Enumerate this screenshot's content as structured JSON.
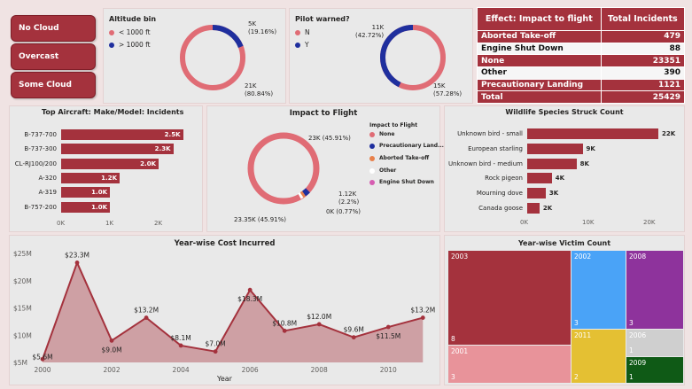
{
  "slicer": {
    "buttons": [
      "No Cloud",
      "Overcast",
      "Some Cloud"
    ]
  },
  "altitude": {
    "title": "Altitude bin",
    "legend": [
      {
        "label": "< 1000 ft",
        "color": "#e06c75"
      },
      {
        "label": "> 1000 ft",
        "color": "#1f2f9e"
      }
    ],
    "label_small_val": "5K",
    "label_small_pct": "(19.16%)",
    "label_large_val": "21K",
    "label_large_pct": "(80.84%)",
    "fraction_blue": 0.1916
  },
  "pilot": {
    "title": "Pilot warned?",
    "legend": [
      {
        "label": "N",
        "color": "#e06c75"
      },
      {
        "label": "Y",
        "color": "#1f2f9e"
      }
    ],
    "label_y_val": "11K",
    "label_y_pct": "(42.72%)",
    "label_n_val": "15K",
    "label_n_pct": "(57.28%)",
    "fraction_blue": 0.4272
  },
  "impact_table": {
    "headers": [
      "Effect: Impact to flight",
      "Total Incidents"
    ],
    "rows": [
      {
        "effect": "Aborted Take-off",
        "count": "479"
      },
      {
        "effect": "Engine Shut Down",
        "count": "88"
      },
      {
        "effect": "None",
        "count": "23351"
      },
      {
        "effect": "Other",
        "count": "390"
      },
      {
        "effect": "Precautionary Landing",
        "count": "1121"
      }
    ],
    "total_label": "Total",
    "total_value": "25429"
  },
  "aircraft": {
    "title": "Top Aircraft: Make/Model: Incidents",
    "categories": [
      "B-737-700",
      "B-737-300",
      "CL-RJ100/200",
      "A-320",
      "A-319",
      "B-757-200"
    ],
    "values": [
      2.5,
      2.3,
      2.0,
      1.2,
      1.0,
      1.0
    ],
    "value_labels": [
      "2.5K",
      "2.3K",
      "2.0K",
      "1.2K",
      "1.0K",
      "1.0K"
    ],
    "ticks": [
      "0K",
      "1K",
      "2K"
    ],
    "xmax": 2.0
  },
  "impact_pie": {
    "title": "Impact to Flight",
    "legend_title": "Impact to Flight",
    "legend": [
      {
        "label": "None",
        "color": "#e06c75"
      },
      {
        "label": "Precautionary Land...",
        "color": "#1f2f9e"
      },
      {
        "label": "Aborted Take-off",
        "color": "#e8804a"
      },
      {
        "label": "Other",
        "color": "#ffffff"
      },
      {
        "label": "Engine Shut Down",
        "color": "#d65db1"
      }
    ],
    "label_top": "23K (45.91%)",
    "label_bottom": "23.35K (45.91%)",
    "label_mid_val": "1.12K",
    "label_mid_pct": "(2.2%)",
    "label_small": "0K (0.77%)"
  },
  "wildlife": {
    "title": "Wildlife Species Struck Count",
    "categories": [
      "Unknown bird - small",
      "European starling",
      "Unknown bird - medium",
      "Rock pigeon",
      "Mourning dove",
      "Canada goose"
    ],
    "values": [
      22,
      9,
      8,
      4,
      3,
      2
    ],
    "value_labels": [
      "22K",
      "9K",
      "8K",
      "4K",
      "3K",
      "2K"
    ],
    "ticks": [
      "0K",
      "10K",
      "20K"
    ],
    "xmax": 20
  },
  "chart_data": {
    "type": "area",
    "title": "Year-wise Cost Incurred",
    "xlabel": "Year",
    "ylabel": "",
    "x": [
      2000,
      2001,
      2002,
      2003,
      2004,
      2005,
      2006,
      2007,
      2008,
      2009,
      2010,
      2011
    ],
    "values": [
      5.6,
      23.3,
      9.0,
      13.2,
      8.1,
      7.0,
      18.3,
      10.8,
      12.0,
      9.6,
      11.5,
      13.2
    ],
    "value_labels": [
      "$5.6M",
      "$23.3M",
      "$9.0M",
      "$13.2M",
      "$8.1M",
      "$7.0M",
      "$18.3M",
      "$10.8M",
      "$12.0M",
      "$9.6M",
      "$11.5M",
      "$13.2M"
    ],
    "ylim": [
      5,
      25
    ],
    "yticks": [
      "$25M",
      "$20M",
      "$15M",
      "$10M",
      "$5M"
    ],
    "xticks": [
      "2000",
      "2002",
      "2004",
      "2006",
      "2008",
      "2010"
    ],
    "color": "#a4323d"
  },
  "victims": {
    "title": "Year-wise Victim Count",
    "cells": [
      {
        "name": "2003",
        "count": "8",
        "color": "#a4323d"
      },
      {
        "name": "2001",
        "count": "3",
        "color": "#e8939a"
      },
      {
        "name": "2002",
        "count": "3",
        "color": "#4aa3f7"
      },
      {
        "name": "2011",
        "count": "2",
        "color": "#e4c033"
      },
      {
        "name": "2008",
        "count": "3",
        "color": "#8e339c"
      },
      {
        "name": "2006",
        "count": "1",
        "color": "#cfcfcf"
      },
      {
        "name": "2009",
        "count": "1",
        "color": "#0f5a16"
      }
    ]
  }
}
